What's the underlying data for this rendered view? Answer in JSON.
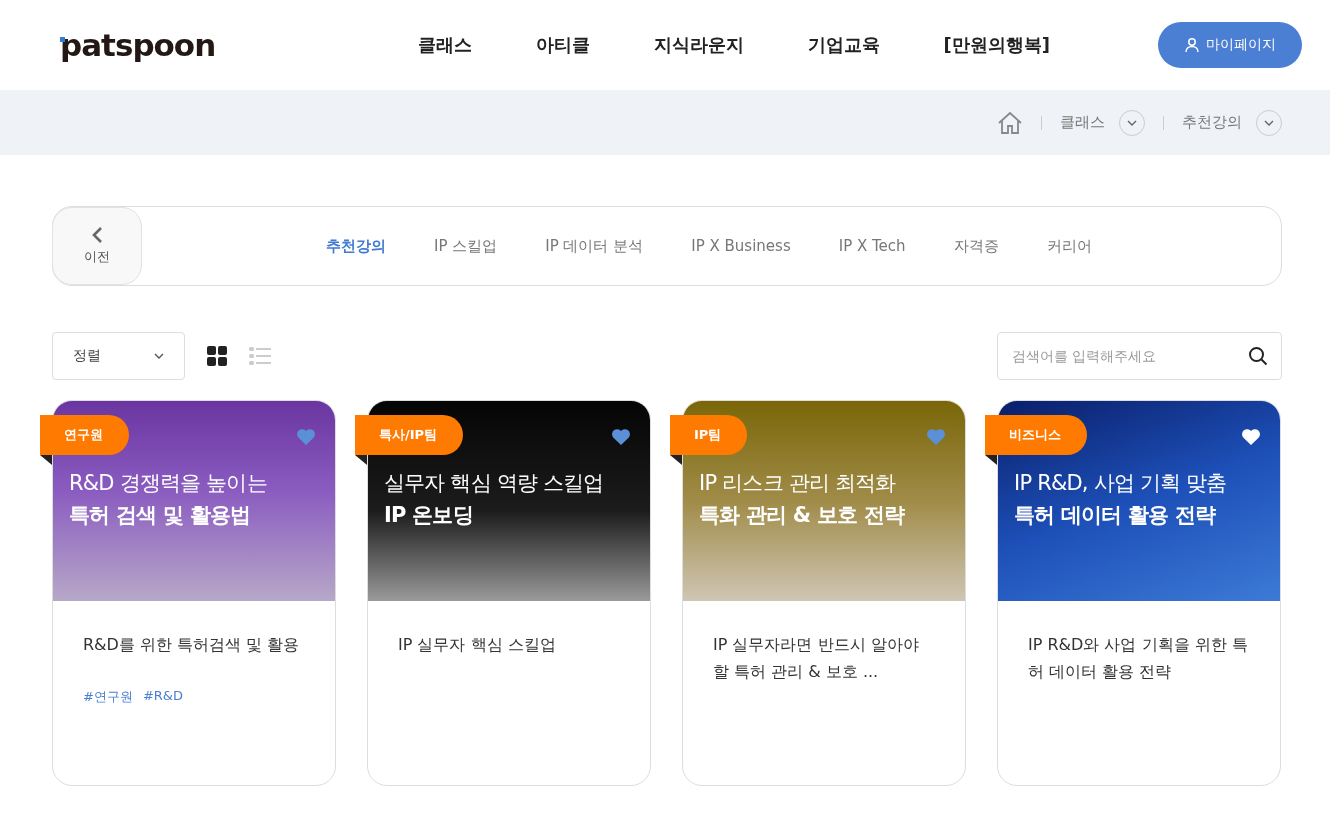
{
  "header": {
    "logo": "patspoon",
    "nav": [
      "클래스",
      "아티클",
      "지식라운지",
      "기업교육",
      "[만원의행복]"
    ],
    "mypage_button": "마이페이지"
  },
  "breadcrumb": [
    "클래스",
    "추천강의"
  ],
  "category_bar": {
    "back_label": "이전",
    "tabs": [
      {
        "label": "추천강의",
        "selected": true
      },
      {
        "label": "IP 스킬업",
        "selected": false
      },
      {
        "label": "IP 데이터 분석",
        "selected": false
      },
      {
        "label": "IP X Business",
        "selected": false
      },
      {
        "label": "IP X Tech",
        "selected": false
      },
      {
        "label": "자격증",
        "selected": false
      },
      {
        "label": "커리어",
        "selected": false
      }
    ]
  },
  "toolbar": {
    "sort_label": "정렬",
    "views": [
      {
        "kind": "grid",
        "selected": true
      },
      {
        "kind": "list",
        "selected": false
      }
    ],
    "search": {
      "placeholder": "검색어를 입력해주세요"
    }
  },
  "courses": [
    {
      "badge": "연구원",
      "liked": true,
      "title_line": "R&D 경쟁력을 높이는",
      "title_bold": "특허 검색 및 활용법",
      "description": "R&D를 위한 특허검색 및 활용",
      "tags": [
        "#연구원",
        "#R&D"
      ]
    },
    {
      "badge": "특사/IP팀",
      "liked": true,
      "title_line": "실무자 핵심 역량 스킬업",
      "title_bold": "IP 온보딩",
      "description": "IP 실무자 핵심 스킬업"
    },
    {
      "badge": "IP팀",
      "liked": true,
      "title_line": "IP 리스크 관리 최적화",
      "title_bold": "특화 관리 & 보호 전략",
      "description": "IP 실무자라면 반드시 알아야 할 특허 관리 & 보호 ..."
    },
    {
      "badge": "비즈니스",
      "liked": false,
      "title_line": "IP R&D, 사업 기획 맞춤",
      "title_bold": "특허 데이터 활용 전략",
      "description": "IP R&D와 사업 기획을 위한 특허 데이터 활용 전략"
    }
  ]
}
